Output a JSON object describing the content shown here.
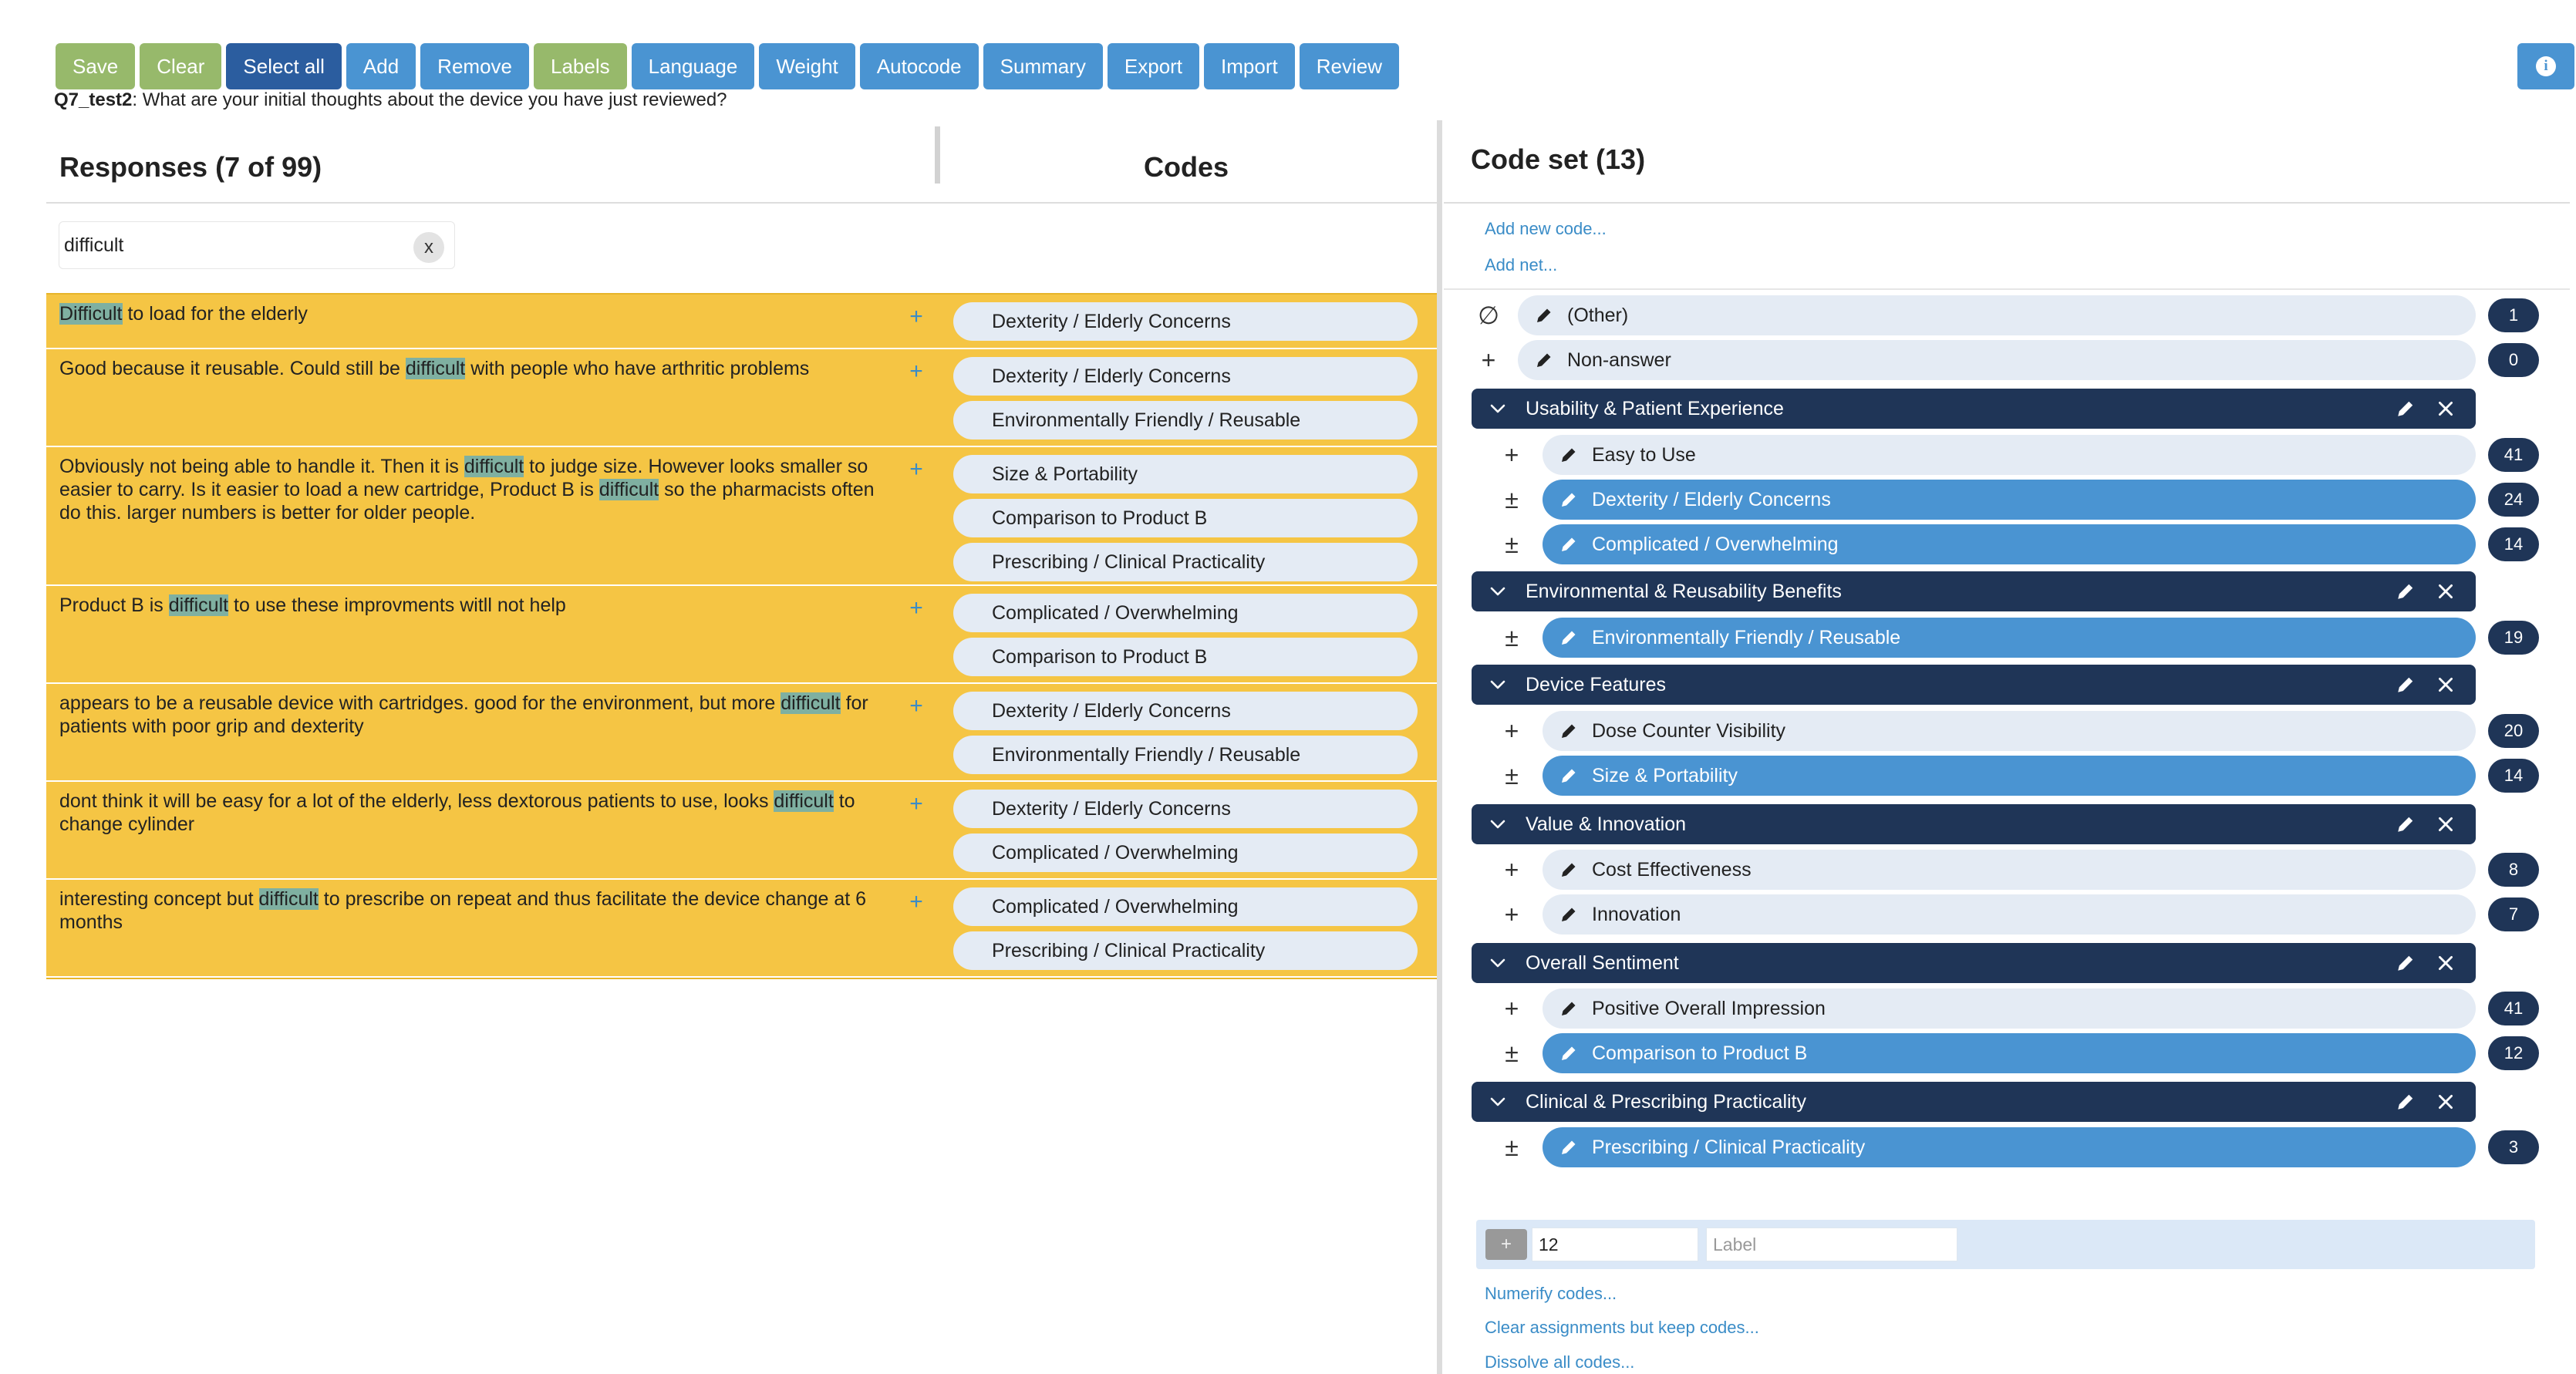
{
  "toolbar": {
    "buttons": [
      {
        "label": "Save",
        "style": "green"
      },
      {
        "label": "Clear",
        "style": "green"
      },
      {
        "label": "Select all",
        "style": "dark"
      },
      {
        "label": "Add",
        "style": "blue"
      },
      {
        "label": "Remove",
        "style": "blue"
      },
      {
        "label": "Labels",
        "style": "green"
      },
      {
        "label": "Language",
        "style": "blue"
      },
      {
        "label": "Weight",
        "style": "blue"
      },
      {
        "label": "Autocode",
        "style": "blue"
      },
      {
        "label": "Summary",
        "style": "blue"
      },
      {
        "label": "Export",
        "style": "blue"
      },
      {
        "label": "Import",
        "style": "blue"
      },
      {
        "label": "Review",
        "style": "blue"
      }
    ],
    "info_icon": "info-icon"
  },
  "question": {
    "id": "Q7_test2",
    "text": ": What are your initial thoughts about the device you have just reviewed?"
  },
  "responses_panel": {
    "title": "Responses (7 of 99)",
    "codes_header": "Codes",
    "search": {
      "value": "difficult",
      "clear_label": "x"
    },
    "highlight_term": "difficult",
    "rows": [
      {
        "text": "Difficult to load for the elderly",
        "codes": [
          "Dexterity / Elderly Concerns"
        ]
      },
      {
        "text": "Good because it reusable. Could still be difficult with people who have arthritic problems",
        "codes": [
          "Dexterity / Elderly Concerns",
          "Environmentally Friendly / Reusable"
        ]
      },
      {
        "text": "Obviously not being able to handle it. Then it is difficult to judge size. However looks smaller so easier to carry. Is it easier to load a new cartridge, Product B is difficult so the pharmacists often do this. larger numbers is better for older people.",
        "codes": [
          "Size & Portability",
          "Comparison to Product B",
          "Prescribing / Clinical Practicality"
        ]
      },
      {
        "text": "Product B is difficult to use these improvments witll not help",
        "codes": [
          "Complicated / Overwhelming",
          "Comparison to Product B"
        ]
      },
      {
        "text": "appears to be a reusable device with cartridges. good for the environment, but more difficult for patients with poor grip and dexterity",
        "codes": [
          "Dexterity / Elderly Concerns",
          "Environmentally Friendly / Reusable"
        ]
      },
      {
        "text": "dont think it will be easy for a lot of the elderly, less dextorous patients to use, looks difficult to change cylinder",
        "codes": [
          "Dexterity / Elderly Concerns",
          "Complicated / Overwhelming"
        ]
      },
      {
        "text": "interesting concept but difficult to prescribe on repeat and thus facilitate the device change at 6 months",
        "codes": [
          "Complicated / Overwhelming",
          "Prescribing / Clinical Practicality"
        ]
      }
    ],
    "add_symbol": "+"
  },
  "codeset": {
    "title": "Code set (13)",
    "add_code_link": "Add new code...",
    "add_net_link": "Add net...",
    "items": [
      {
        "kind": "code",
        "symbol": "∅",
        "label": "(Other)",
        "count": "1",
        "selected": false,
        "indent": false
      },
      {
        "kind": "code",
        "symbol": "+",
        "label": "Non-answer",
        "count": "0",
        "selected": false,
        "indent": false
      },
      {
        "kind": "net",
        "label": "Usability & Patient Experience"
      },
      {
        "kind": "code",
        "symbol": "+",
        "label": "Easy to Use",
        "count": "41",
        "selected": false,
        "indent": true
      },
      {
        "kind": "code",
        "symbol": "±",
        "label": "Dexterity / Elderly Concerns",
        "count": "24",
        "selected": true,
        "indent": true
      },
      {
        "kind": "code",
        "symbol": "±",
        "label": "Complicated / Overwhelming",
        "count": "14",
        "selected": true,
        "indent": true
      },
      {
        "kind": "net",
        "label": "Environmental & Reusability Benefits"
      },
      {
        "kind": "code",
        "symbol": "±",
        "label": "Environmentally Friendly / Reusable",
        "count": "19",
        "selected": true,
        "indent": true
      },
      {
        "kind": "net",
        "label": "Device Features"
      },
      {
        "kind": "code",
        "symbol": "+",
        "label": "Dose Counter Visibility",
        "count": "20",
        "selected": false,
        "indent": true
      },
      {
        "kind": "code",
        "symbol": "±",
        "label": "Size & Portability",
        "count": "14",
        "selected": true,
        "indent": true
      },
      {
        "kind": "net",
        "label": "Value & Innovation"
      },
      {
        "kind": "code",
        "symbol": "+",
        "label": "Cost Effectiveness",
        "count": "8",
        "selected": false,
        "indent": true
      },
      {
        "kind": "code",
        "symbol": "+",
        "label": "Innovation",
        "count": "7",
        "selected": false,
        "indent": true
      },
      {
        "kind": "net",
        "label": "Overall Sentiment"
      },
      {
        "kind": "code",
        "symbol": "+",
        "label": "Positive Overall Impression",
        "count": "41",
        "selected": false,
        "indent": true
      },
      {
        "kind": "code",
        "symbol": "±",
        "label": "Comparison to Product B",
        "count": "12",
        "selected": true,
        "indent": true
      },
      {
        "kind": "net",
        "label": "Clinical & Prescribing Practicality"
      },
      {
        "kind": "code",
        "symbol": "±",
        "label": "Prescribing / Clinical Practicality",
        "count": "3",
        "selected": true,
        "indent": true
      }
    ],
    "new_code": {
      "add_symbol": "+",
      "number_value": "12",
      "label_placeholder": "Label"
    },
    "numerify_link": "Numerify codes...",
    "clear_assignments_link": "Clear assignments but keep codes...",
    "dissolve_link": "Dissolve all codes..."
  },
  "colors": {
    "green_button": "#97b96b",
    "dark_button": "#2b5d9f",
    "blue_button": "#4a94d2",
    "response_bg": "#f5c544",
    "highlight": "#7fb0a1",
    "net_bg": "#1f3557",
    "code_pill_light": "#e4ebf4",
    "code_pill_selected": "#4a94d2"
  }
}
